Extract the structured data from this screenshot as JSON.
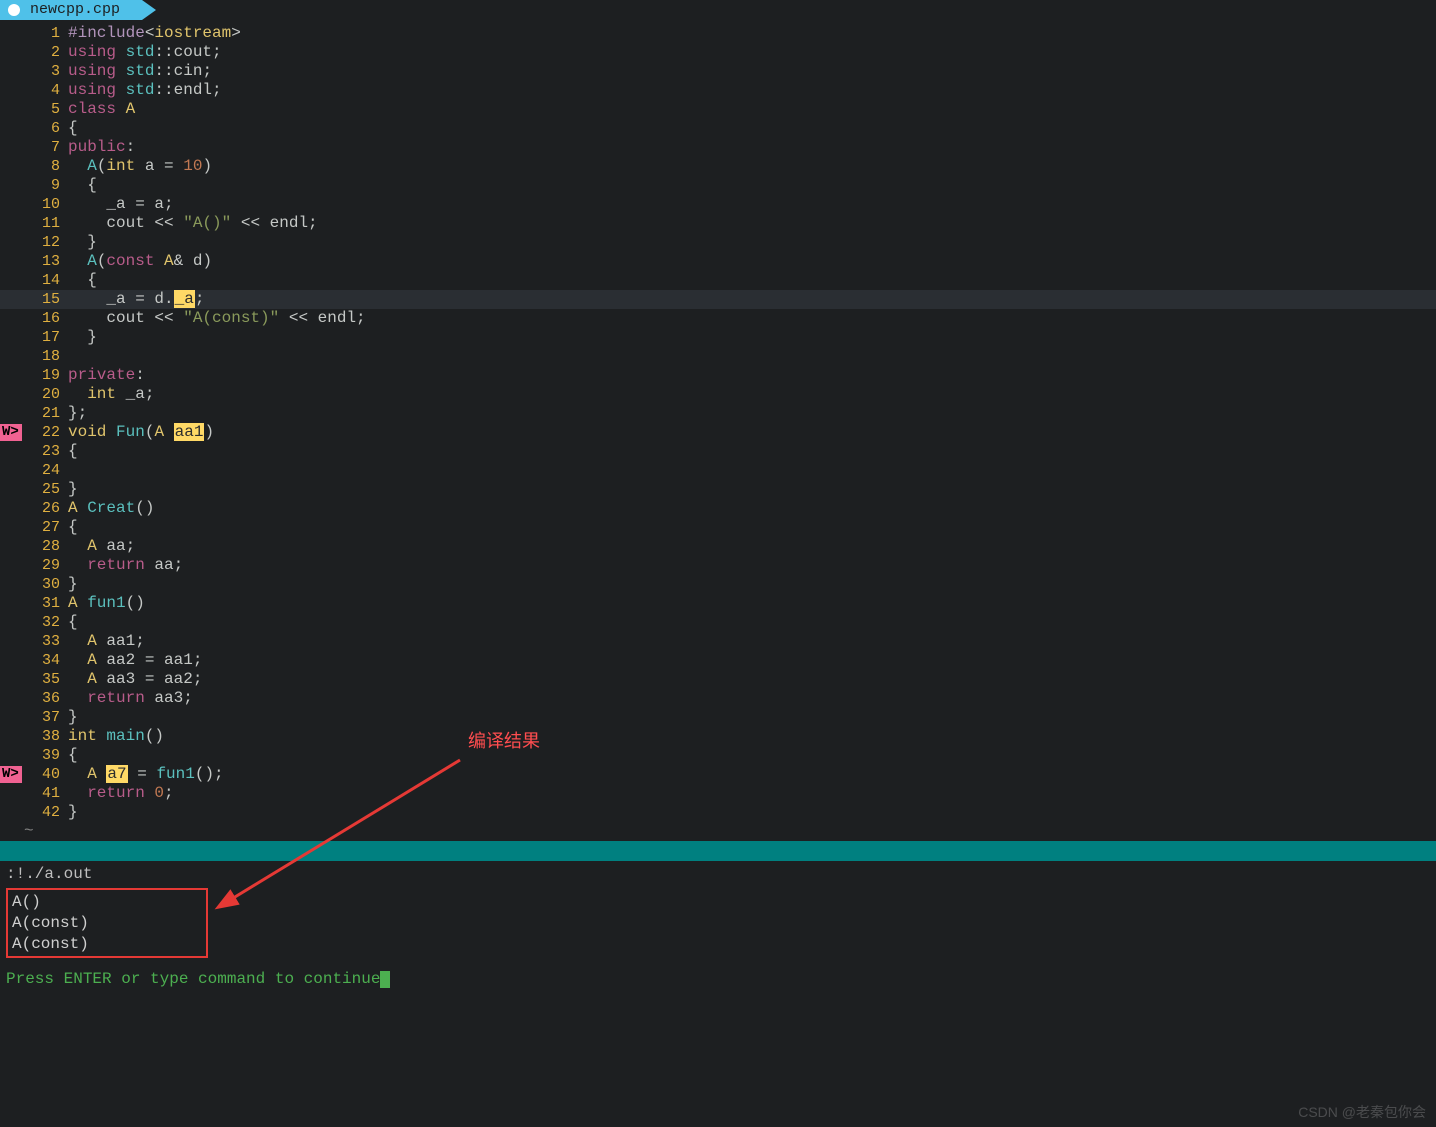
{
  "tab": {
    "filename": "newcpp.cpp"
  },
  "warn": "W>",
  "lines": {
    "l1": [
      {
        "c": "acc",
        "t": "#include"
      },
      {
        "c": "op",
        "t": "<"
      },
      {
        "c": "type",
        "t": "iostream"
      },
      {
        "c": "op",
        "t": ">"
      }
    ],
    "l2": [
      {
        "c": "kw",
        "t": "using "
      },
      {
        "c": "ns",
        "t": "std"
      },
      {
        "c": "op",
        "t": "::"
      },
      {
        "c": "ident",
        "t": "cout"
      },
      {
        "c": "op",
        "t": ";"
      }
    ],
    "l3": [
      {
        "c": "kw",
        "t": "using "
      },
      {
        "c": "ns",
        "t": "std"
      },
      {
        "c": "op",
        "t": "::"
      },
      {
        "c": "ident",
        "t": "cin"
      },
      {
        "c": "op",
        "t": ";"
      }
    ],
    "l4": [
      {
        "c": "kw",
        "t": "using "
      },
      {
        "c": "ns",
        "t": "std"
      },
      {
        "c": "op",
        "t": "::"
      },
      {
        "c": "ident",
        "t": "endl"
      },
      {
        "c": "op",
        "t": ";"
      }
    ],
    "l5": [
      {
        "c": "kw",
        "t": "class "
      },
      {
        "c": "type",
        "t": "A"
      }
    ],
    "l6": [
      {
        "c": "op",
        "t": "{"
      }
    ],
    "l7": [
      {
        "c": "kw",
        "t": "public"
      },
      {
        "c": "op",
        "t": ":"
      }
    ],
    "l8": [
      {
        "c": "op",
        "t": "  "
      },
      {
        "c": "fn",
        "t": "A"
      },
      {
        "c": "op",
        "t": "("
      },
      {
        "c": "type",
        "t": "int"
      },
      {
        "c": "op",
        "t": " a = "
      },
      {
        "c": "num",
        "t": "10"
      },
      {
        "c": "op",
        "t": ")"
      }
    ],
    "l9": [
      {
        "c": "op",
        "t": "  {"
      }
    ],
    "l10": [
      {
        "c": "op",
        "t": "    _a = a;"
      }
    ],
    "l11": [
      {
        "c": "op",
        "t": "    cout << "
      },
      {
        "c": "str",
        "t": "\"A()\""
      },
      {
        "c": "op",
        "t": " << "
      },
      {
        "c": "ident",
        "t": "endl"
      },
      {
        "c": "op",
        "t": ";"
      }
    ],
    "l12": [
      {
        "c": "op",
        "t": "  }"
      }
    ],
    "l13": [
      {
        "c": "op",
        "t": "  "
      },
      {
        "c": "fn",
        "t": "A"
      },
      {
        "c": "op",
        "t": "("
      },
      {
        "c": "kw",
        "t": "const"
      },
      {
        "c": "op",
        "t": " "
      },
      {
        "c": "type",
        "t": "A"
      },
      {
        "c": "op",
        "t": "& d)"
      }
    ],
    "l14": [
      {
        "c": "op",
        "t": "  {"
      }
    ],
    "l15": [
      {
        "c": "op",
        "t": "    _a = d."
      },
      {
        "c": "hl",
        "t": "_a"
      },
      {
        "c": "op",
        "t": ";"
      }
    ],
    "l16": [
      {
        "c": "op",
        "t": "    cout << "
      },
      {
        "c": "str",
        "t": "\"A(const)\""
      },
      {
        "c": "op",
        "t": " << "
      },
      {
        "c": "ident",
        "t": "endl"
      },
      {
        "c": "op",
        "t": ";"
      }
    ],
    "l17": [
      {
        "c": "op",
        "t": "  }"
      }
    ],
    "l18": [
      {
        "c": "op",
        "t": ""
      }
    ],
    "l19": [
      {
        "c": "kw",
        "t": "private"
      },
      {
        "c": "op",
        "t": ":"
      }
    ],
    "l20": [
      {
        "c": "op",
        "t": "  "
      },
      {
        "c": "type",
        "t": "int"
      },
      {
        "c": "op",
        "t": " _a;"
      }
    ],
    "l21": [
      {
        "c": "op",
        "t": "};"
      }
    ],
    "l22": [
      {
        "c": "type",
        "t": "void "
      },
      {
        "c": "fn",
        "t": "Fun"
      },
      {
        "c": "op",
        "t": "("
      },
      {
        "c": "type",
        "t": "A"
      },
      {
        "c": "op",
        "t": " "
      },
      {
        "c": "hl",
        "t": "aa1"
      },
      {
        "c": "op",
        "t": ")"
      }
    ],
    "l23": [
      {
        "c": "op",
        "t": "{"
      }
    ],
    "l24": [
      {
        "c": "op",
        "t": ""
      }
    ],
    "l25": [
      {
        "c": "op",
        "t": "}"
      }
    ],
    "l26": [
      {
        "c": "type",
        "t": "A "
      },
      {
        "c": "fn",
        "t": "Creat"
      },
      {
        "c": "op",
        "t": "()"
      }
    ],
    "l27": [
      {
        "c": "op",
        "t": "{"
      }
    ],
    "l28": [
      {
        "c": "op",
        "t": "  "
      },
      {
        "c": "type",
        "t": "A"
      },
      {
        "c": "op",
        "t": " aa;"
      }
    ],
    "l29": [
      {
        "c": "op",
        "t": "  "
      },
      {
        "c": "kw",
        "t": "return"
      },
      {
        "c": "op",
        "t": " aa;"
      }
    ],
    "l30": [
      {
        "c": "op",
        "t": "}"
      }
    ],
    "l31": [
      {
        "c": "type",
        "t": "A "
      },
      {
        "c": "fn",
        "t": "fun1"
      },
      {
        "c": "op",
        "t": "()"
      }
    ],
    "l32": [
      {
        "c": "op",
        "t": "{"
      }
    ],
    "l33": [
      {
        "c": "op",
        "t": "  "
      },
      {
        "c": "type",
        "t": "A"
      },
      {
        "c": "op",
        "t": " aa1;"
      }
    ],
    "l34": [
      {
        "c": "op",
        "t": "  "
      },
      {
        "c": "type",
        "t": "A"
      },
      {
        "c": "op",
        "t": " aa2 = aa1;"
      }
    ],
    "l35": [
      {
        "c": "op",
        "t": "  "
      },
      {
        "c": "type",
        "t": "A"
      },
      {
        "c": "op",
        "t": " aa3 = aa2;"
      }
    ],
    "l36": [
      {
        "c": "op",
        "t": "  "
      },
      {
        "c": "kw",
        "t": "return"
      },
      {
        "c": "op",
        "t": " aa3;"
      }
    ],
    "l37": [
      {
        "c": "op",
        "t": "}"
      }
    ],
    "l38": [
      {
        "c": "type",
        "t": "int "
      },
      {
        "c": "fn",
        "t": "main"
      },
      {
        "c": "op",
        "t": "()"
      }
    ],
    "l39": [
      {
        "c": "op",
        "t": "{"
      }
    ],
    "l40": [
      {
        "c": "op",
        "t": "  "
      },
      {
        "c": "type",
        "t": "A"
      },
      {
        "c": "op",
        "t": " "
      },
      {
        "c": "hl",
        "t": "a7"
      },
      {
        "c": "op",
        "t": " = "
      },
      {
        "c": "fn",
        "t": "fun1"
      },
      {
        "c": "op",
        "t": "();"
      }
    ],
    "l41": [
      {
        "c": "op",
        "t": "  "
      },
      {
        "c": "kw",
        "t": "return"
      },
      {
        "c": "op",
        "t": " "
      },
      {
        "c": "num",
        "t": "0"
      },
      {
        "c": "op",
        "t": ";"
      }
    ],
    "l42": [
      {
        "c": "op",
        "t": "}"
      }
    ]
  },
  "tilde": "~",
  "term": {
    "cmd": ":!./a.out",
    "out": [
      "A()",
      "A(const)",
      "A(const)"
    ],
    "prompt": "Press ENTER or type command to continue"
  },
  "annotation": "编译结果",
  "watermark": "CSDN @老秦包你会",
  "meta": {
    "currentLine": 15,
    "warnLines": [
      22,
      40
    ]
  }
}
